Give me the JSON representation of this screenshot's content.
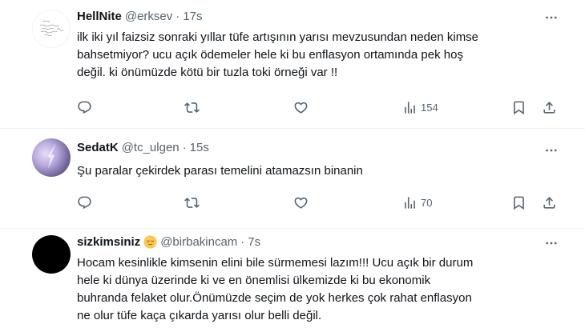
{
  "tweets": [
    {
      "name": "HellNite",
      "handle": "@erksev",
      "dot": "·",
      "time": "17s",
      "text": "ilk iki yıl faizsiz sonraki yıllar tüfe artışının yarısı mevzusundan neden kimse\nbahsetmiyor? ucu açık ödemeler hele ki bu enflasyon ortamında pek hoş\ndeğil. ki önümüzde kötü bir tuzla toki örneği var !!",
      "views": "154"
    },
    {
      "name": "SedatK",
      "handle": "@tc_ulgen",
      "dot": "·",
      "time": "15s",
      "text": "Şu paralar çekirdek parası temelini atamazsın binanin",
      "views": "70"
    },
    {
      "name": "sizkimsiniz",
      "handle": "@birbakincam",
      "dot": "·",
      "time": "7s",
      "text": "Hocam kesinlikle kimsenin elini bile sürmemesi lazım!!! Ucu açık bir durum\nhele ki dünya üzerinde ki ve en önemlisi ülkemizde ki bu ekonomik\nbuhranda felaket olur.Önümüzde seçim de yok herkes çok rahat enflasyon\nne olur tüfe kaça çıkarda yarısı olur belli değil."
    }
  ],
  "icons": {
    "reply": "reply-icon",
    "retweet": "retweet-icon",
    "like": "heart-icon",
    "views": "views-icon",
    "bookmark": "bookmark-icon",
    "share": "share-icon",
    "more": "more-icon"
  },
  "colors": {
    "text": "#0f1419",
    "secondary": "#536471",
    "divider": "#eff3f4"
  }
}
